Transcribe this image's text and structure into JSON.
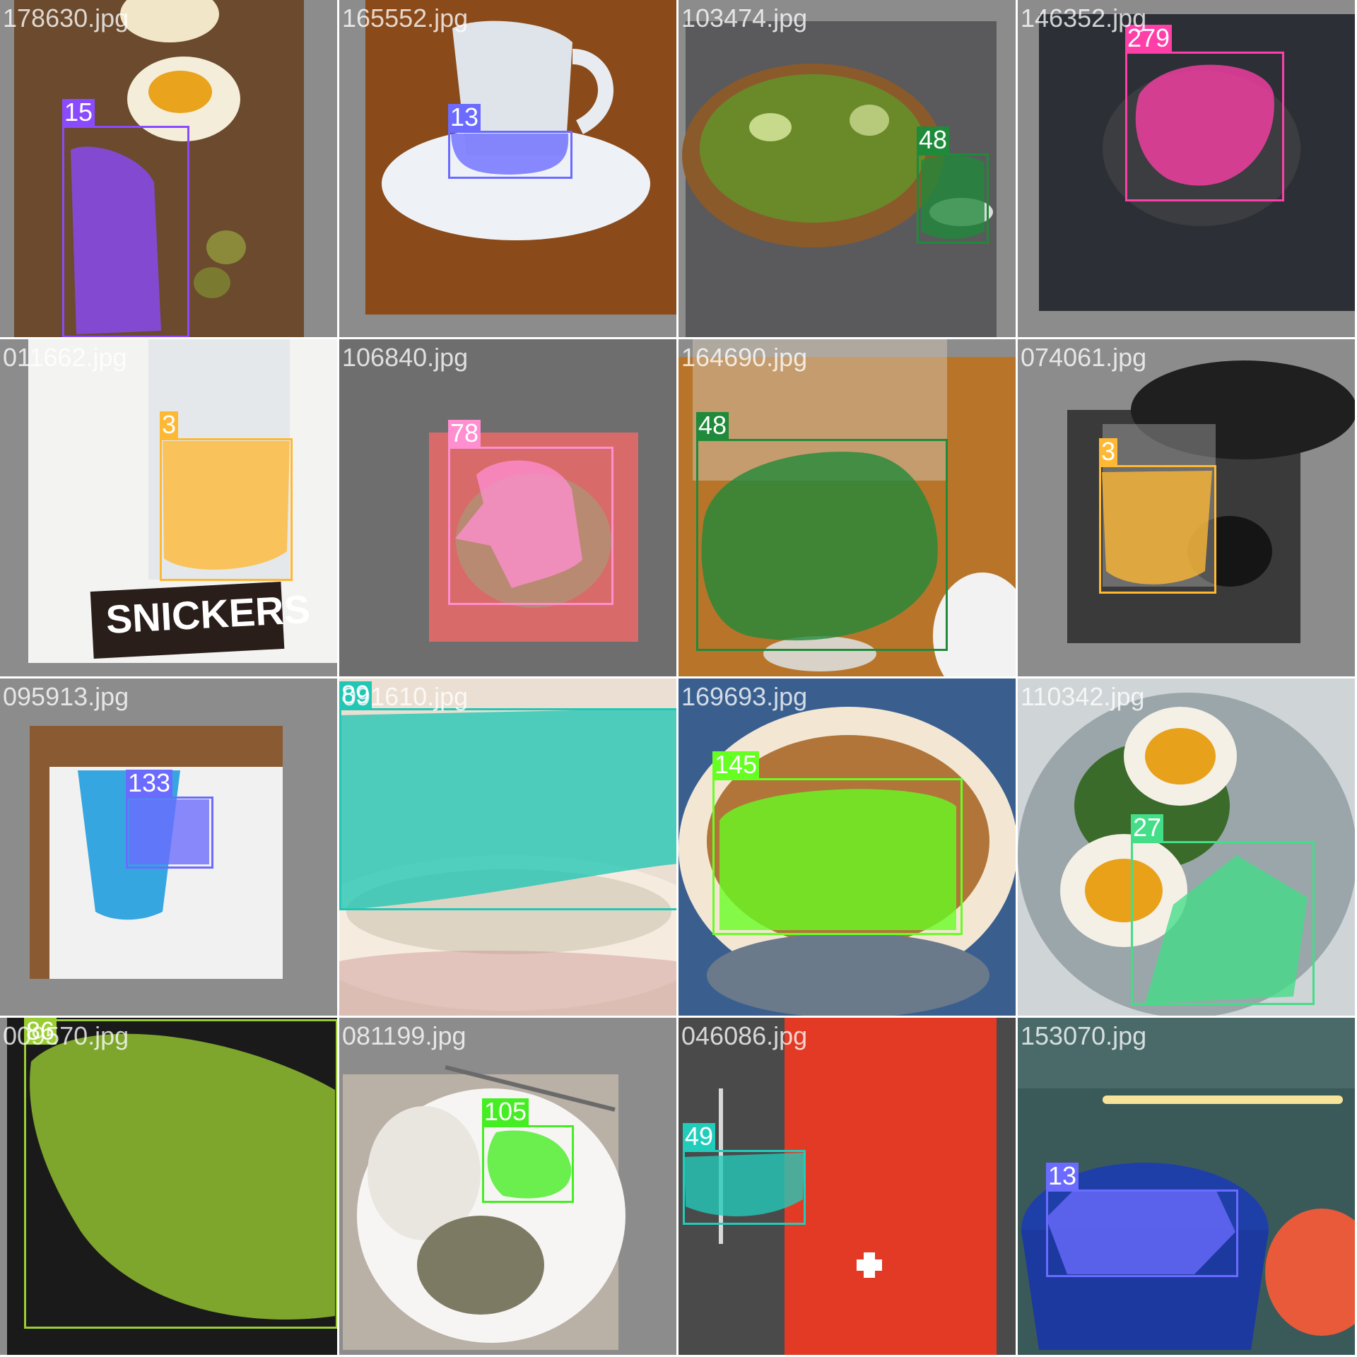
{
  "mosaic": {
    "tiles": [
      {
        "file": "178630.jpg",
        "scene": "wood",
        "labels": [
          {
            "class_id": "15",
            "color": "#8a4bff"
          }
        ]
      },
      {
        "file": "165552.jpg",
        "scene": "cup",
        "labels": [
          {
            "class_id": "13",
            "color": "#6b6bff"
          }
        ]
      },
      {
        "file": "103474.jpg",
        "scene": "salad",
        "labels": [
          {
            "class_id": "48",
            "color": "#1f8a3a"
          }
        ]
      },
      {
        "file": "146352.jpg",
        "scene": "dark",
        "labels": [
          {
            "class_id": "279",
            "color": "#ff3fa8"
          }
        ]
      },
      {
        "file": "011662.jpg",
        "scene": "white",
        "labels": [
          {
            "class_id": "3",
            "color": "#ffb833"
          }
        ]
      },
      {
        "file": "106840.jpg",
        "scene": "pink",
        "labels": [
          {
            "class_id": "78",
            "color": "#ff8fd0"
          }
        ]
      },
      {
        "file": "164690.jpg",
        "scene": "glass",
        "labels": [
          {
            "class_id": "48",
            "color": "#1f8a3a"
          }
        ]
      },
      {
        "file": "074061.jpg",
        "scene": "darkglass",
        "labels": [
          {
            "class_id": "3",
            "color": "#ffb833"
          }
        ]
      },
      {
        "file": "095913.jpg",
        "scene": "bluecup",
        "labels": [
          {
            "class_id": "133",
            "color": "#6b6bff"
          }
        ]
      },
      {
        "file": "091610.jpg",
        "scene": "plate",
        "labels": [
          {
            "class_id": "89",
            "color": "#22c6b5"
          }
        ]
      },
      {
        "file": "169693.jpg",
        "scene": "bowl",
        "labels": [
          {
            "class_id": "145",
            "color": "#66ff22"
          }
        ]
      },
      {
        "file": "110342.jpg",
        "scene": "eggs",
        "labels": [
          {
            "class_id": "27",
            "color": "#44dd88"
          }
        ]
      },
      {
        "file": "009570.jpg",
        "scene": "bread",
        "labels": [
          {
            "class_id": "86",
            "color": "#9acd32"
          }
        ]
      },
      {
        "file": "081199.jpg",
        "scene": "rice",
        "labels": [
          {
            "class_id": "105",
            "color": "#44ee22"
          }
        ]
      },
      {
        "file": "046086.jpg",
        "scene": "redbag",
        "labels": [
          {
            "class_id": "49",
            "color": "#22ccbb"
          }
        ]
      },
      {
        "file": "153070.jpg",
        "scene": "mug",
        "labels": [
          {
            "class_id": "13",
            "color": "#6b6bff"
          }
        ]
      }
    ]
  }
}
